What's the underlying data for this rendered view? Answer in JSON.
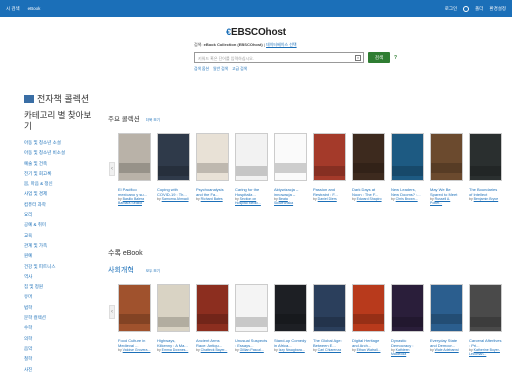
{
  "topbar": {
    "left": [
      "시 검색",
      "eBook"
    ],
    "right": [
      "로그인",
      "폴더",
      "환경설정"
    ]
  },
  "logo": {
    "mark": "€",
    "text": "EBSCOhost"
  },
  "search": {
    "db_prefix": "검색:",
    "db_name": "eBook Collection (EBSCOhost)",
    "db_link": "데이터베이스 선택",
    "placeholder": "키워드 혹은 단어를 입력하십시오.",
    "clear": "×",
    "button": "검색",
    "help": "?",
    "links": [
      "검색 옵션",
      "일반 검색",
      "고급 검색"
    ]
  },
  "collection_title": "전자책 콜렉션",
  "sidebar": {
    "heading": "카테고리 별 찾아보기",
    "items": [
      "아동 및 청소년 소설",
      "아동 및 청소년 비소설",
      "예술 및 건축",
      "전기 및 회고록",
      "몸, 마음 & 정신",
      "사업 및 경제",
      "컴퓨터 과학",
      "요리",
      "공예 & 취미",
      "교육",
      "관계 및 가족",
      "원예",
      "건강 및 피트니스",
      "역사",
      "집 및 정원",
      "유머",
      "법학",
      "문학 컬렉션",
      "수학",
      "의학",
      "음악",
      "철학",
      "사진"
    ]
  },
  "featured": {
    "title": "주요 콜렉션",
    "more": "더욱 보기",
    "prev": "‹",
    "books": [
      {
        "title": "El Pacifico mexicano y su...",
        "author": "Basilio Balera",
        "author2": "Barbara Sedilla"
      },
      {
        "title": "Coping with COVID-19 : Th...",
        "author": "Samorna Ahmadi",
        "author2": ""
      },
      {
        "title": "Psychoanalysis and the Fa...",
        "author": "Richard Bates",
        "author2": ""
      },
      {
        "title": "Caring for the Hospitaliz...",
        "author": "Section on Hospital Medic...",
        "author2": ""
      },
      {
        "title": "Aktywizacja – innowacja – rozwój...",
        "author": "Beata Skowrońska",
        "author2": ""
      },
      {
        "title": "Passion and Restraint : F...",
        "author": "Daniel Diers",
        "author2": ""
      },
      {
        "title": "Dark Days at Noon : The F...",
        "author": "Edward Shapiro",
        "author2": ""
      },
      {
        "title": "New Leaders, New Dooms? :...",
        "author": "Chris Brown...",
        "author2": ""
      },
      {
        "title": "May We Be Spared to Meet",
        "author": "Russell A. Potter...",
        "author2": ""
      },
      {
        "title": "The Boundaries of Intellect",
        "author": "Benjamin Bryce",
        "author2": ""
      }
    ]
  },
  "ebook_section": {
    "title": "수록 eBook",
    "category": "사회개혁",
    "more": "모두 보기",
    "prev": "‹",
    "books": [
      {
        "title": "Food Culture in Medieval ...",
        "author": "Valoise Grovera...",
        "author2": ""
      },
      {
        "title": "Highways, Kilkenny : A Ma...",
        "author": "Emma Downes...",
        "author2": ""
      },
      {
        "title": "Ancient Arms Race: Antiqu...",
        "author": "Chatteck Bayer...",
        "author2": ""
      },
      {
        "title": "Unusual Suspects : Essays...",
        "author": "Gillian Pascal...",
        "author2": ""
      },
      {
        "title": "Stand-up Comedy in Africa...",
        "author": "Izzy Nwagbara...",
        "author2": ""
      },
      {
        "title": "The Global Age: Between E...",
        "author": "Carl Chiarenza",
        "author2": ""
      },
      {
        "title": "Digital Heritage and Arch...",
        "author": "Ethan Watrall...",
        "author2": ""
      },
      {
        "title": "Dynastic Democracy : Poli...",
        "author": "Kathleen Macleoda",
        "author2": ""
      },
      {
        "title": "Everyday State and Democr...",
        "author": "Wale Adebanwi",
        "author2": ""
      },
      {
        "title": "Carceral Afterlives : Pri...",
        "author": "Katherine Boyer-Lecoman...",
        "author2": ""
      }
    ]
  },
  "cover_colors": {
    "featured": [
      "#b9b2a8",
      "#2f3a4a",
      "#e8e1d6",
      "#f2f2f2",
      "#fafafa",
      "#a43a2a",
      "#3d2a1e",
      "#1d5a82",
      "#6b4a2e",
      "#2a2f2f"
    ],
    "ebook": [
      "#a0522d",
      "#d9d3c4",
      "#8c2e1f",
      "#f4f4f4",
      "#1d1f24",
      "#2b3f5c",
      "#b83a1c",
      "#2a1e3a",
      "#2b5e8e",
      "#4a4a4a"
    ]
  }
}
